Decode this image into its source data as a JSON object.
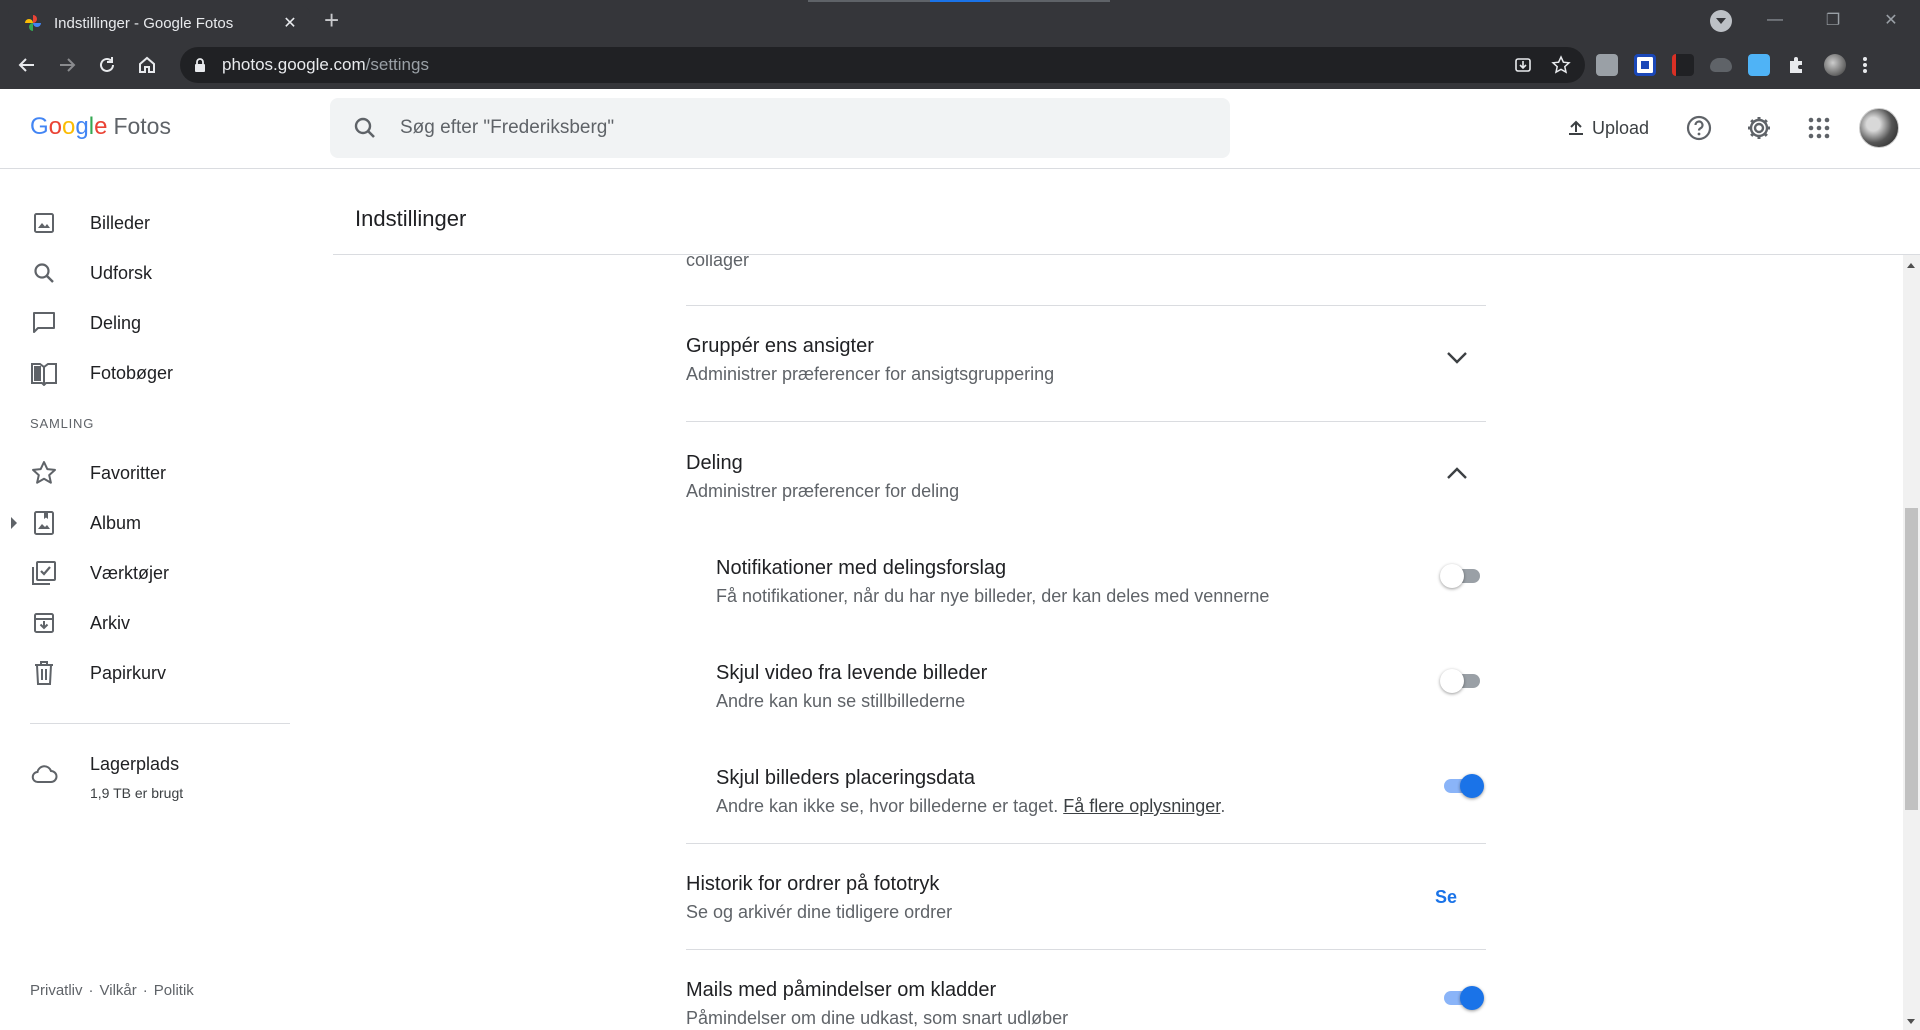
{
  "browser": {
    "tab_title": "Indstillinger - Google Fotos",
    "url_host": "photos.google.com",
    "url_path": "/settings"
  },
  "header": {
    "logo_google": [
      "G",
      "o",
      "o",
      "g",
      "l",
      "e"
    ],
    "logo_product": "Fotos",
    "search_placeholder": "Søg efter \"Frederiksberg\"",
    "upload_label": "Upload"
  },
  "colors": {
    "accent": "#1a73e8",
    "google_blue": "#4285f4",
    "google_red": "#ea4335",
    "google_yellow": "#fbbc05",
    "google_green": "#34a853"
  },
  "sidebar": {
    "items": [
      {
        "label": "Billeder",
        "icon": "photo-icon"
      },
      {
        "label": "Udforsk",
        "icon": "search-icon"
      },
      {
        "label": "Deling",
        "icon": "chat-icon"
      },
      {
        "label": "Fotobøger",
        "icon": "book-icon"
      }
    ],
    "section_label": "SAMLING",
    "collection_items": [
      {
        "label": "Favoritter",
        "icon": "star-icon"
      },
      {
        "label": "Album",
        "icon": "album-icon"
      },
      {
        "label": "Værktøjer",
        "icon": "tools-icon"
      },
      {
        "label": "Arkiv",
        "icon": "archive-icon"
      },
      {
        "label": "Papirkurv",
        "icon": "trash-icon"
      }
    ],
    "storage": {
      "label": "Lagerplads",
      "usage": "1,9 TB er brugt"
    },
    "footer_links": [
      "Privatliv",
      "·",
      "Vilkår",
      "·",
      "Politik"
    ]
  },
  "page": {
    "title": "Indstillinger",
    "cut_text": "collager",
    "settings": {
      "group_faces": {
        "title": "Gruppér ens ansigter",
        "subtitle": "Administrer præferencer for ansigtsgruppering",
        "expanded": false
      },
      "sharing": {
        "title": "Deling",
        "subtitle": "Administrer præferencer for deling",
        "expanded": true
      },
      "share_suggestions": {
        "title": "Notifikationer med delingsforslag",
        "subtitle": "Få notifikationer, når du har nye billeder, der kan deles med vennerne",
        "enabled": false
      },
      "hide_video": {
        "title": "Skjul video fra levende billeder",
        "subtitle": "Andre kan kun se stillbillederne",
        "enabled": false
      },
      "hide_location": {
        "title": "Skjul billeders placeringsdata",
        "subtitle": "Andre kan ikke se, hvor billederne er taget.",
        "link": "Få flere oplysninger",
        "after_link": ".",
        "enabled": true
      },
      "print_history": {
        "title": "Historik for ordrer på fototryk",
        "subtitle": "Se og arkivér dine tidligere ordrer",
        "action": "Se"
      },
      "draft_reminders": {
        "title": "Mails med påmindelser om kladder",
        "subtitle": "Påmindelser om dine udkast, som snart udløber",
        "enabled": true
      }
    }
  }
}
